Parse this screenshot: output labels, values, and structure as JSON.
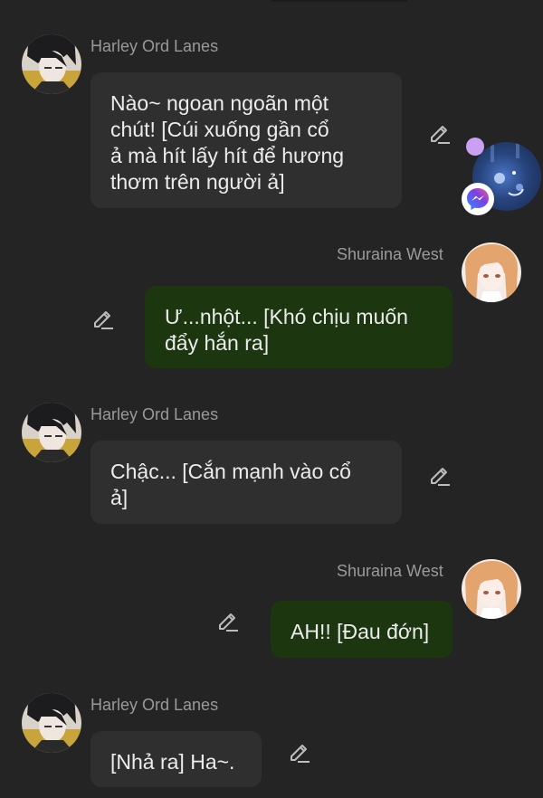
{
  "characters": {
    "harley": "Harley Ord Lanes",
    "shuraina": "Shuraina West"
  },
  "messages": [
    {
      "sender": "Harley Ord Lanes",
      "text": "Nào~ ngoan ngoãn một\nchút! [Cúi xuống gần cổ\nả mà hít lấy hít để hương\nthơm trên người ả]"
    },
    {
      "sender": "Shuraina West",
      "text": "Ư...nhột... [Khó chịu muốn\nđẩy hắn ra]"
    },
    {
      "sender": "Harley Ord Lanes",
      "text": "Chậc... [Cắn mạnh vào cổ\nả]"
    },
    {
      "sender": "Shuraina West",
      "text": "AH!! [Đau đớn]"
    },
    {
      "sender": "Harley Ord Lanes",
      "text": "[Nhả ra] Ha~."
    }
  ],
  "icons": {
    "edit": "pencil-edit-icon",
    "messenger": "messenger-icon"
  },
  "colors": {
    "background": "#242424",
    "character_bubble": "#2f2f2f",
    "user_bubble": "#1c3610",
    "name_text": "#9a9a9a",
    "message_text": "#ececec",
    "messenger_accent": "#7b3fe4"
  }
}
